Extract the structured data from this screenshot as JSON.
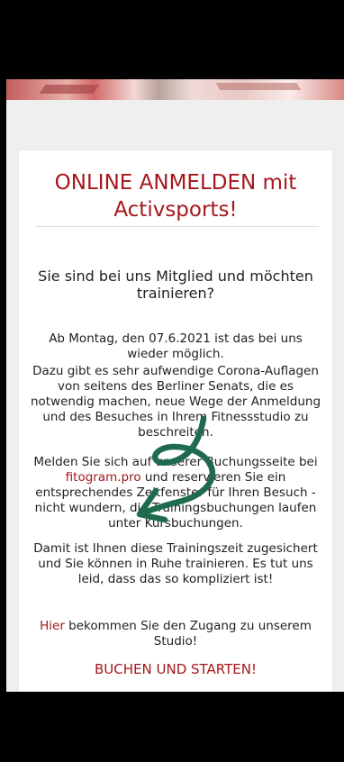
{
  "hero": {
    "image_name": "sports-banner-image"
  },
  "card": {
    "title": "ONLINE ANMELDEN mit Activsports!",
    "subheading": "Sie sind bei uns Mitglied und möchten trainieren?",
    "paragraph1": "Ab Montag, den 07.6.2021 ist das bei uns wieder möglich.",
    "paragraph2": "Dazu gibt es sehr aufwendige Corona-Auflagen von seitens des Berliner Senats, die es notwendig machen, neue Wege der Anmeldung und des Besuches in Ihrem Fitnessstudio zu beschreiten.",
    "paragraph3_before": "Melden Sie sich auf unserer Buchungsseite bei ",
    "paragraph3_link": "fitogram.pro",
    "paragraph3_after": " und reservieren Sie ein entsprechendes Zeitfenster für Ihren Besuch - nicht wundern, die Trainingsbuchungen laufen unter Kursbuchungen.",
    "paragraph4": "Damit ist Ihnen diese Trainingszeit zugesichert und Sie können in Ruhe trainieren. Es tut uns leid, dass das so kompliziert ist!",
    "access_link": "Hier",
    "access_text": " bekommen Sie den Zugang zu unserem Studio!",
    "cta_label": "BUCHEN UND STARTEN!"
  },
  "colors": {
    "accent": "#a5171b",
    "annotation": "#1e6b4e",
    "page_background": "#efefef",
    "card_background": "#ffffff"
  }
}
